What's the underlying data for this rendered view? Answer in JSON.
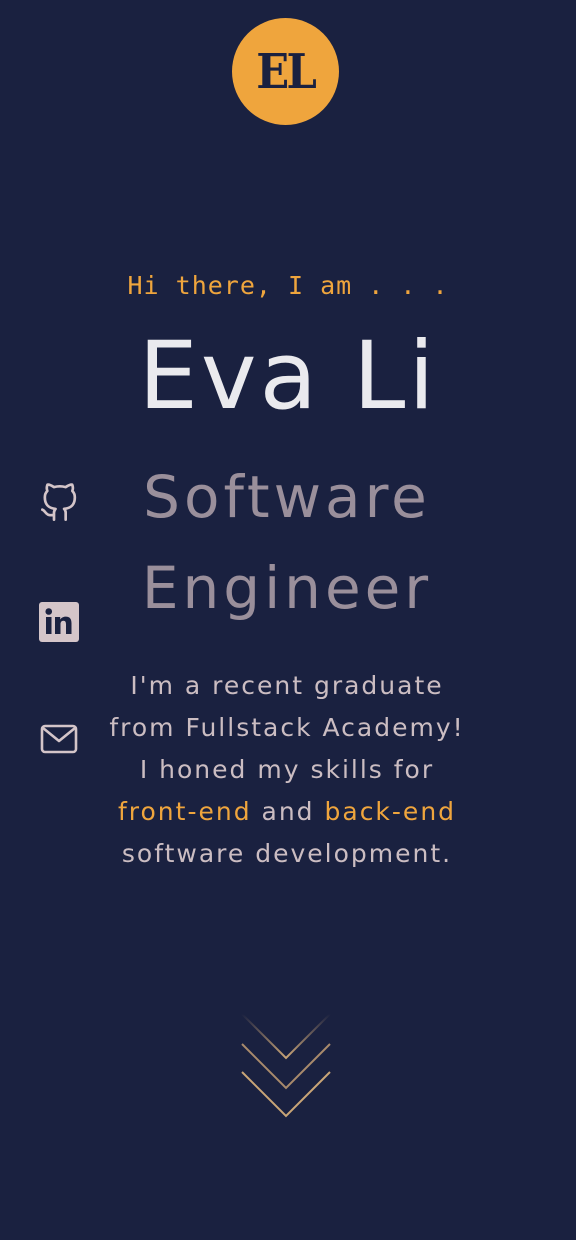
{
  "logo": {
    "text": "EL",
    "bg_color": "#efa53d"
  },
  "hero": {
    "greeting": "Hi there, I am . . .",
    "name": "Eva Li",
    "title_line1": "Software",
    "title_line2": "Engineer"
  },
  "bio": {
    "part1": "I'm a recent graduate from Fullstack Academy! I honed my skills for ",
    "highlight1": "front-end",
    "part2": " and ",
    "highlight2": "back-end",
    "part3": " software development."
  },
  "social": [
    {
      "icon": "github-icon"
    },
    {
      "icon": "linkedin-icon"
    },
    {
      "icon": "mail-icon"
    }
  ],
  "scroll": {
    "icon": "chevron-down-icon"
  },
  "colors": {
    "background": "#1a2140",
    "accent": "#efa53d",
    "name": "#eaeaee",
    "title": "#9a8f9b",
    "body": "#cbbdc2",
    "icon": "#d4c5c9"
  }
}
